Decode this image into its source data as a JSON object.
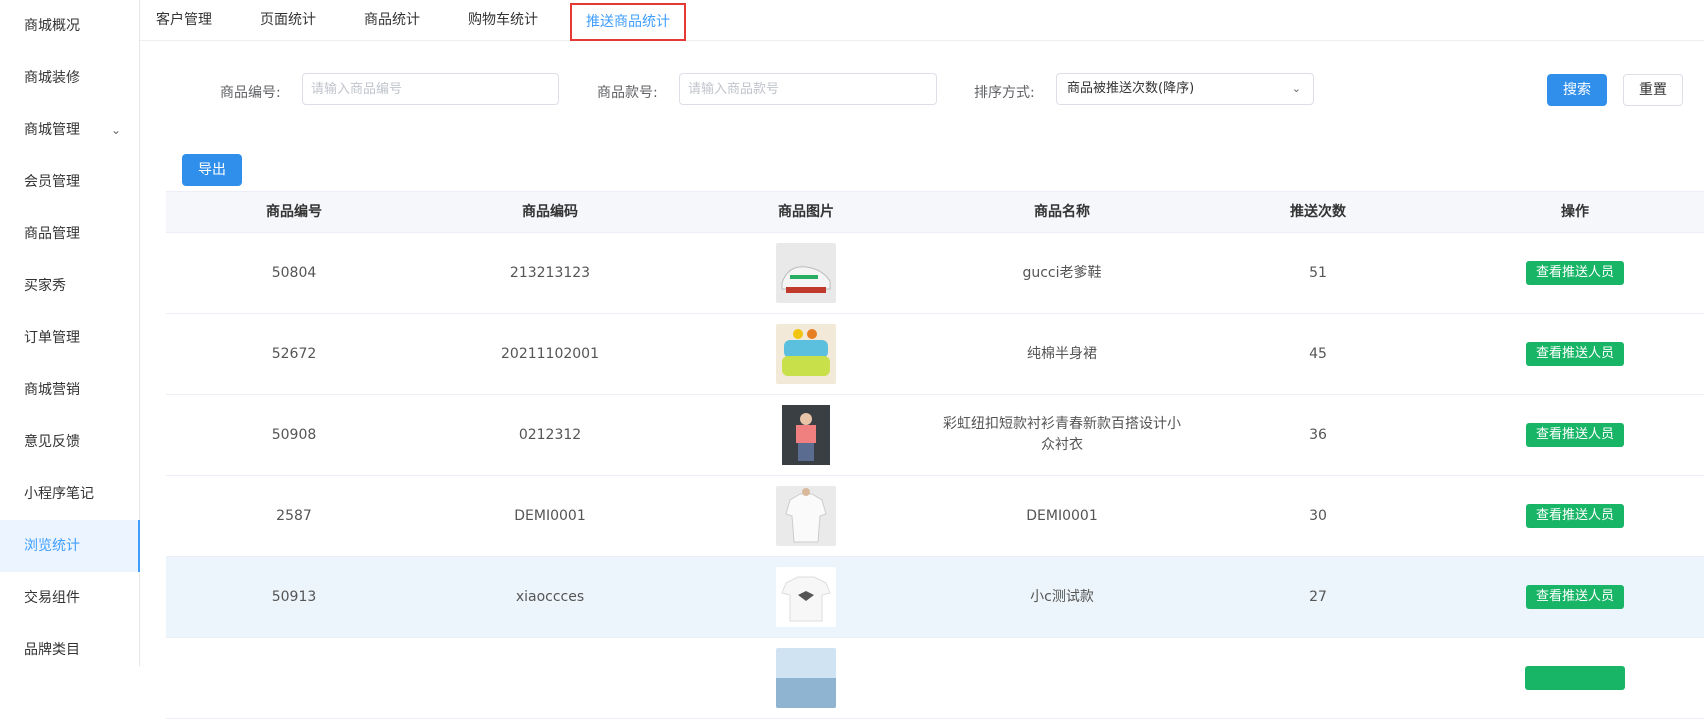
{
  "sidebar": {
    "items": [
      {
        "label": "商城概况"
      },
      {
        "label": "商城装修"
      },
      {
        "label": "商城管理"
      },
      {
        "label": "会员管理"
      },
      {
        "label": "商品管理"
      },
      {
        "label": "买家秀"
      },
      {
        "label": "订单管理"
      },
      {
        "label": "商城营销"
      },
      {
        "label": "意见反馈"
      },
      {
        "label": "小程序笔记"
      },
      {
        "label": "浏览统计"
      },
      {
        "label": "交易组件"
      },
      {
        "label": "品牌类目"
      }
    ],
    "active_index": 10
  },
  "tabs": [
    {
      "label": "客户管理"
    },
    {
      "label": "页面统计"
    },
    {
      "label": "商品统计"
    },
    {
      "label": "购物车统计"
    },
    {
      "label": "推送商品统计"
    }
  ],
  "filters": {
    "product_no_label": "商品编号:",
    "product_no_placeholder": "请输入商品编号",
    "style_no_label": "商品款号:",
    "style_no_placeholder": "请输入商品款号",
    "sort_label": "排序方式:",
    "sort_value": "商品被推送次数(降序)",
    "search_label": "搜索",
    "reset_label": "重置"
  },
  "export_label": "导出",
  "table": {
    "headers": [
      "商品编号",
      "商品编码",
      "商品图片",
      "商品名称",
      "推送次数",
      "操作"
    ],
    "rows": [
      {
        "id": "50804",
        "code": "213213123",
        "name": "gucci老爹鞋",
        "count": "51",
        "action": "查看推送人员"
      },
      {
        "id": "52672",
        "code": "20211102001",
        "name": "纯棉半身裙",
        "count": "45",
        "action": "查看推送人员"
      },
      {
        "id": "50908",
        "code": "0212312",
        "name": "彩虹纽扣短款衬衫青春新款百搭设计小众衬衣",
        "count": "36",
        "action": "查看推送人员"
      },
      {
        "id": "2587",
        "code": "DEMI0001",
        "name": "DEMI0001",
        "count": "30",
        "action": "查看推送人员"
      },
      {
        "id": "50913",
        "code": "xiaoccces",
        "name": "小c测试款",
        "count": "27",
        "action": "查看推送人员"
      },
      {
        "id": "",
        "code": "",
        "name": "",
        "count": "",
        "action": ""
      }
    ]
  },
  "colors": {
    "primary": "#2f8fea",
    "success": "#18b566",
    "active_tab_border": "#e53935"
  }
}
